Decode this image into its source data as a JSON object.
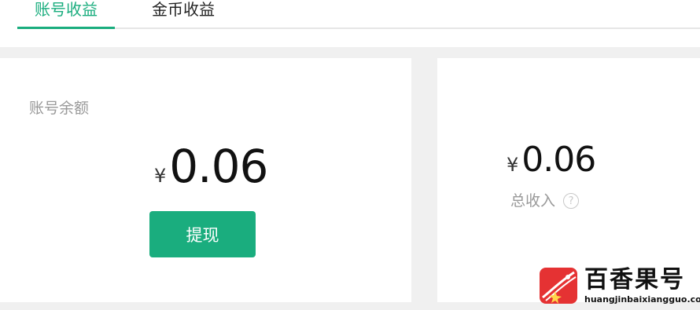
{
  "tabs": {
    "account_earnings": "账号收益",
    "coin_earnings": "金币收益"
  },
  "account_card": {
    "label": "账号余额",
    "currency": "¥",
    "amount": "0.06",
    "withdraw_label": "提现"
  },
  "total_card": {
    "currency": "¥",
    "amount": "0.06",
    "label": "总收入",
    "help_icon_text": "?"
  },
  "watermark": {
    "title": "百香果号",
    "url": "huangjinbaixiangguo.com"
  },
  "colors": {
    "accent": "#1aad7e",
    "panel_bg": "#f0f0f0",
    "watermark_red": "#e53233"
  }
}
